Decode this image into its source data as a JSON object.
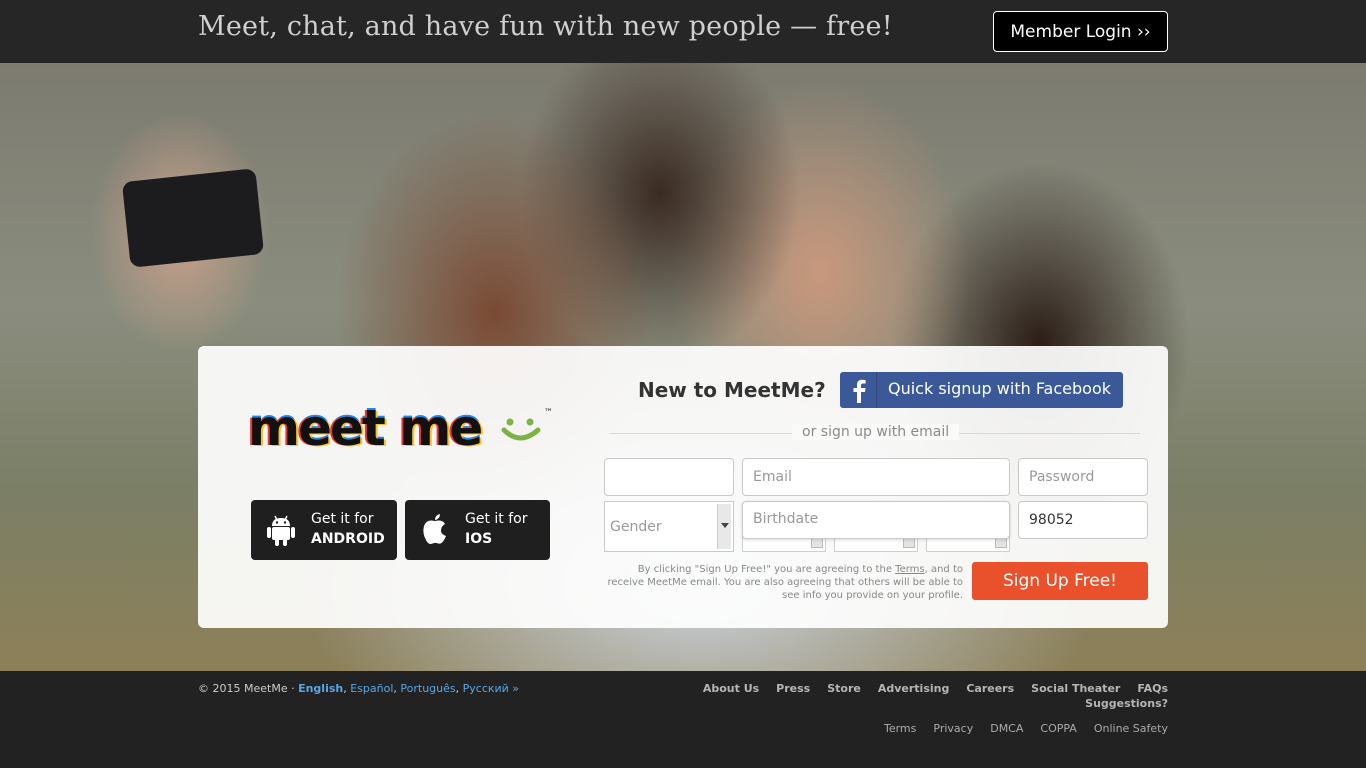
{
  "header": {
    "tagline": "Meet, chat, and have fun with new people — free!",
    "login_label": "Member Login ››"
  },
  "logo": {
    "text": "meet me",
    "tm": "™"
  },
  "apps": {
    "android": {
      "line1": "Get it for",
      "line2": "ANDROID",
      "icon": "android-icon"
    },
    "ios": {
      "line1": "Get it for",
      "line2": "IOS",
      "icon": "apple-icon"
    }
  },
  "signup": {
    "heading": "New to MeetMe?",
    "facebook_label": "Quick signup with Facebook",
    "or_text": "or sign up with email",
    "name_value": "",
    "email_placeholder": "Email",
    "password_placeholder": "Password",
    "gender_placeholder": "Gender",
    "birthdate_placeholder": "Birthdate",
    "zip_value": "98052",
    "terms_prefix": "By clicking \"Sign Up Free!\" you are agreeing to the ",
    "terms_link": "Terms",
    "terms_suffix": ", and to receive MeetMe email. You are also agreeing that others will be able to see info you provide on your profile.",
    "button_label": "Sign Up Free!"
  },
  "colors": {
    "facebook": "#3b5998",
    "signup": "#e8512b",
    "link": "#57a6e6"
  },
  "footer": {
    "copyright": "© 2015 MeetMe ·",
    "languages": [
      "English",
      "Español",
      "Português",
      "Русский »"
    ],
    "links": [
      "About Us",
      "Press",
      "Store",
      "Advertising",
      "Careers",
      "Social Theater",
      "FAQs"
    ],
    "suggestions": "Suggestions?",
    "links2": [
      "Terms",
      "Privacy",
      "DMCA",
      "COPPA",
      "Online Safety"
    ]
  }
}
